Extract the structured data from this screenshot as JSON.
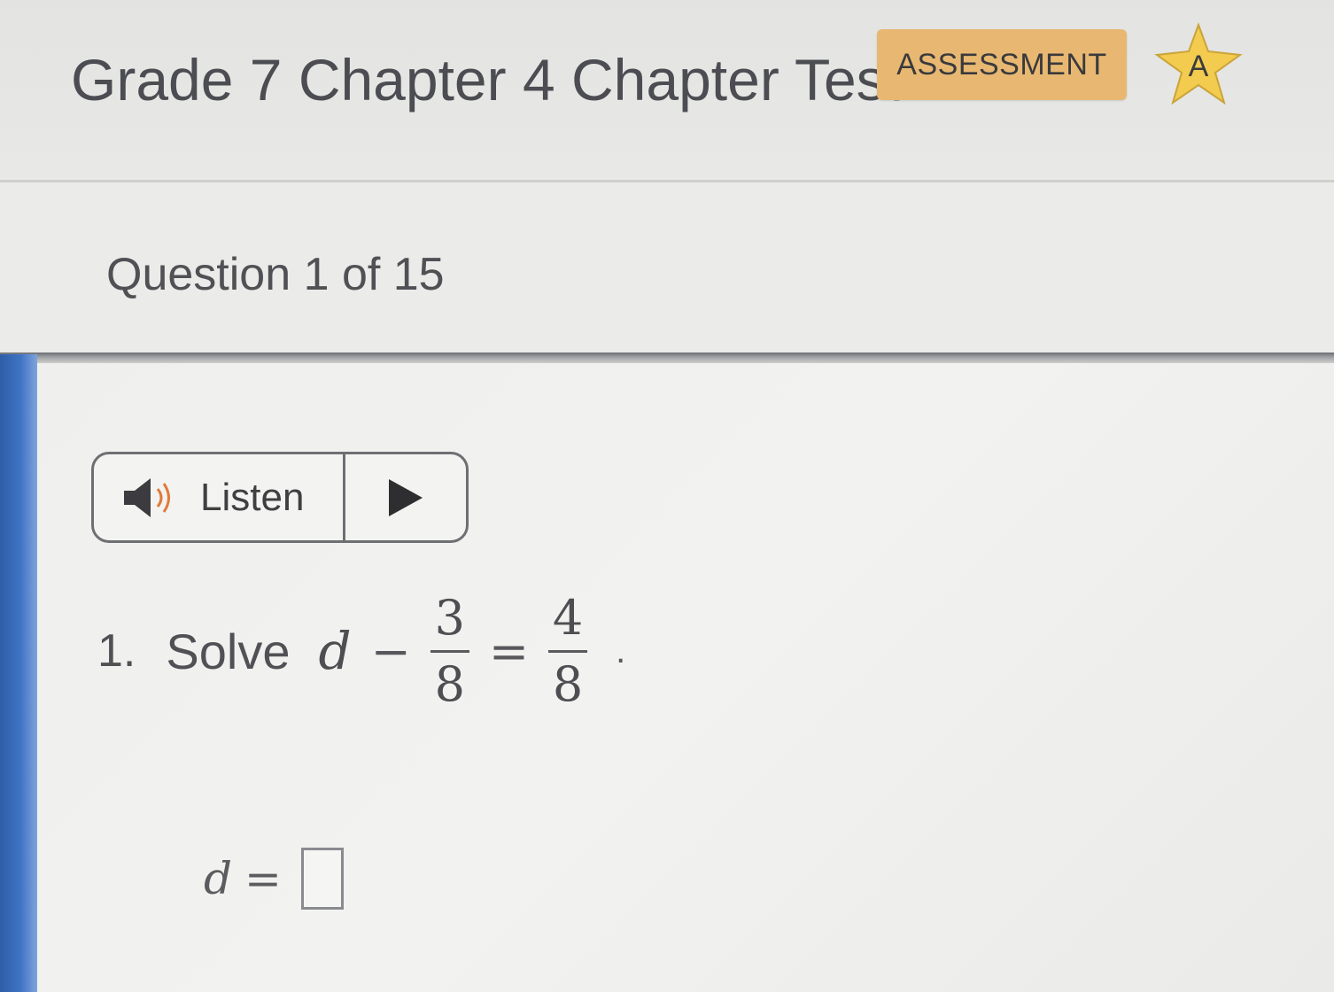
{
  "header": {
    "title": "Grade 7 Chapter 4 Chapter Test",
    "badge": "ASSESSMENT",
    "star_letter": "A",
    "star_color": "#f2cb4f"
  },
  "question_bar": {
    "counter": "Question 1 of 15"
  },
  "listen": {
    "label": "Listen",
    "speaker_icon": "speaker-icon",
    "play_icon": "play-icon"
  },
  "question": {
    "number": "1.",
    "prompt": "Solve",
    "variable": "d",
    "minus": "−",
    "frac1_num": "3",
    "frac1_den": "8",
    "equals": "=",
    "frac2_num": "4",
    "frac2_den": "8",
    "period": "."
  },
  "answer": {
    "variable": "d",
    "equals": "=",
    "value": ""
  },
  "colors": {
    "badge_bg": "#e8b872",
    "accent_blue": "#3f73c4"
  }
}
